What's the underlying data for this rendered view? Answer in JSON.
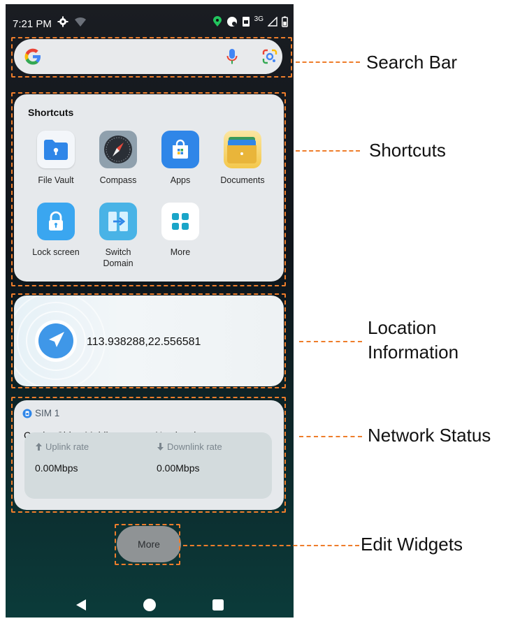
{
  "status_bar": {
    "time": "7:21 PM",
    "network_type": "3G"
  },
  "search_bar": {
    "google_icon": "google-g-icon",
    "mic_icon": "microphone-icon",
    "lens_icon": "google-lens-icon"
  },
  "shortcuts": {
    "title": "Shortcuts",
    "items": [
      {
        "label": "File Vault",
        "icon": "file-vault-icon"
      },
      {
        "label": "Compass",
        "icon": "compass-icon"
      },
      {
        "label": "Apps",
        "icon": "apps-store-icon"
      },
      {
        "label": "Documents",
        "icon": "documents-icon"
      },
      {
        "label": "Lock screen",
        "icon": "lock-icon"
      },
      {
        "label": "Switch Domain",
        "icon": "switch-domain-icon"
      },
      {
        "label": "More",
        "icon": "more-grid-icon"
      }
    ]
  },
  "location": {
    "coordinates": "113.938288,22.556581"
  },
  "network": {
    "sim_label": "SIM 1",
    "carrier": "Carrier:China Mobile",
    "signal": "No signal",
    "uplink_label": "Uplink rate",
    "uplink_value": "0.00Mbps",
    "downlink_label": "Downlink rate",
    "downlink_value": "0.00Mbps"
  },
  "more_button": "More",
  "annotations": {
    "search_bar": "Search Bar",
    "shortcuts": "Shortcuts",
    "location_line1": "Location",
    "location_line2": "Information",
    "network_status": "Network Status",
    "edit_widgets": "Edit Widgets"
  },
  "colors": {
    "annotation": "#ee7d2b",
    "card": "#e6e9ec",
    "accent_blue": "#2b8cf0"
  }
}
